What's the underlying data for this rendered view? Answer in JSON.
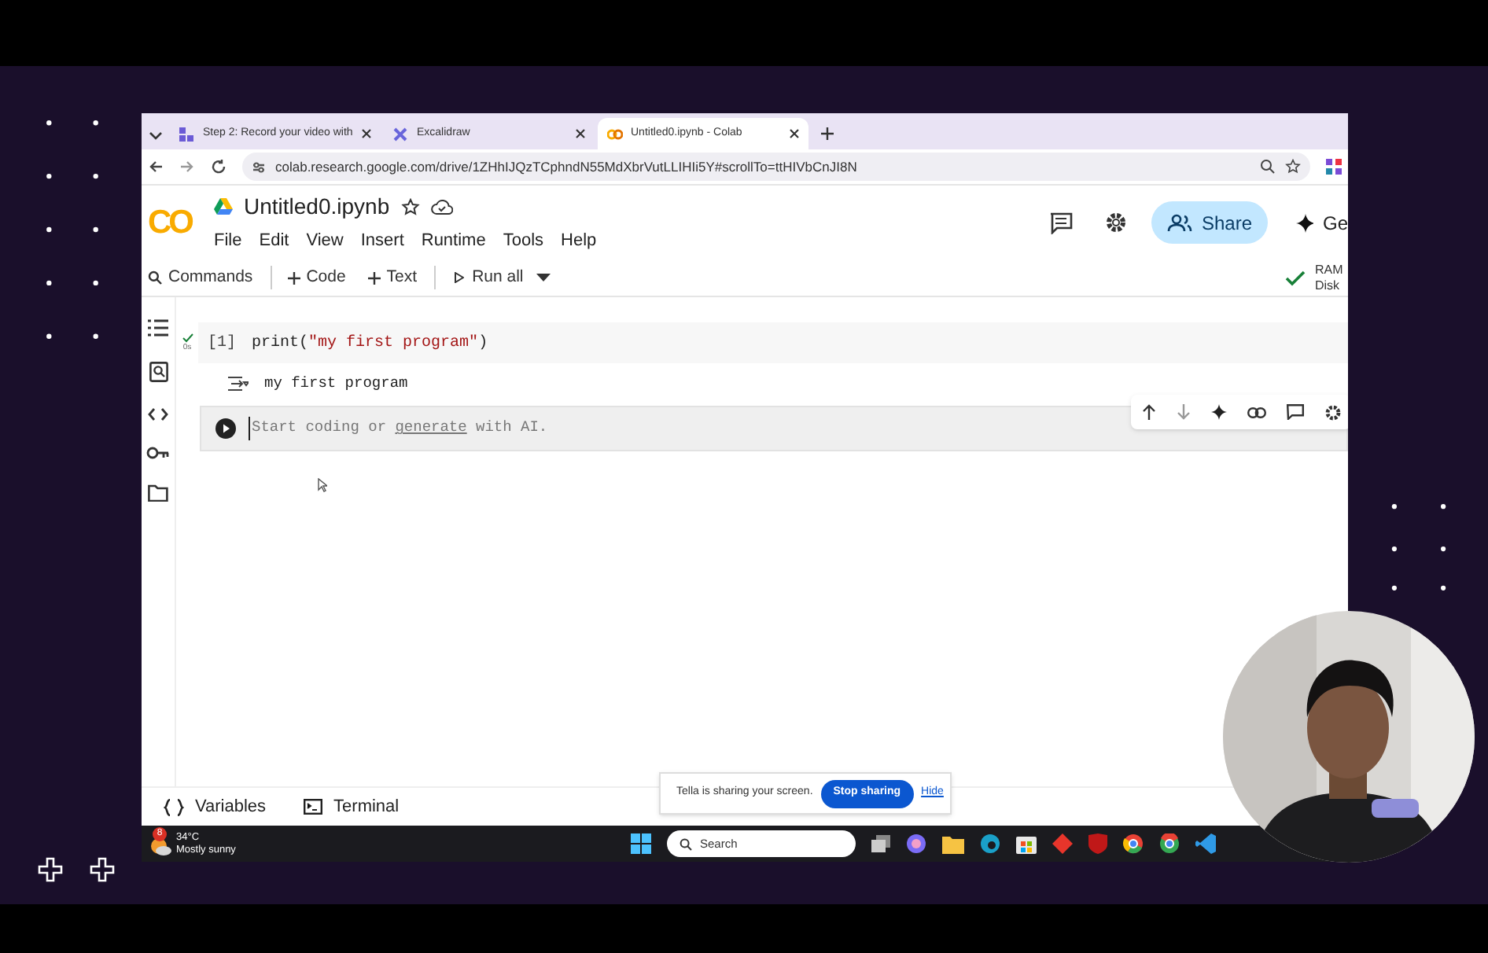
{
  "browser": {
    "tabs": [
      {
        "label": "Step 2: Record your video with",
        "selected": false
      },
      {
        "label": "Excalidraw",
        "selected": false
      },
      {
        "label": "Untitled0.ipynb - Colab",
        "selected": true
      }
    ],
    "url": "colab.research.google.com/drive/1ZHhIJQzTCphndN55MdXbrVutLLIHIi5Y#scrollTo=ttHIVbCnJI8N"
  },
  "notebook": {
    "logo": "CO",
    "title": "Untitled0.ipynb",
    "menu": [
      "File",
      "Edit",
      "View",
      "Insert",
      "Runtime",
      "Tools",
      "Help"
    ],
    "share": "Share",
    "gemini": "Ge"
  },
  "toolbar": {
    "commands": "Commands",
    "items": [
      "Code",
      "Text"
    ],
    "run_all": "Run all",
    "ram": "RAM",
    "disk": "Disk"
  },
  "cells": [
    {
      "kind": "code",
      "exec_count": "[1]",
      "time": "0s",
      "source": [
        {
          "kind": "name",
          "text": "print("
        },
        {
          "kind": "string",
          "text": "\"my first program\""
        },
        {
          "kind": "name",
          "text": ")"
        }
      ],
      "output": "my first program"
    },
    {
      "kind": "empty",
      "placeholder": [
        {
          "kind": "plain",
          "text": "Start coding or "
        },
        {
          "kind": "link",
          "text": "generate"
        },
        {
          "kind": "plain",
          "text": " with AI."
        }
      ]
    }
  ],
  "bottom_tabs": [
    "Variables",
    "Terminal"
  ],
  "share_banner": {
    "message": "Tella is sharing your screen.",
    "button": "Stop sharing",
    "link": "Hide"
  },
  "taskbar": {
    "badge": "8",
    "temperature": "34°C",
    "weather": "Mostly sunny",
    "search": "Search"
  }
}
